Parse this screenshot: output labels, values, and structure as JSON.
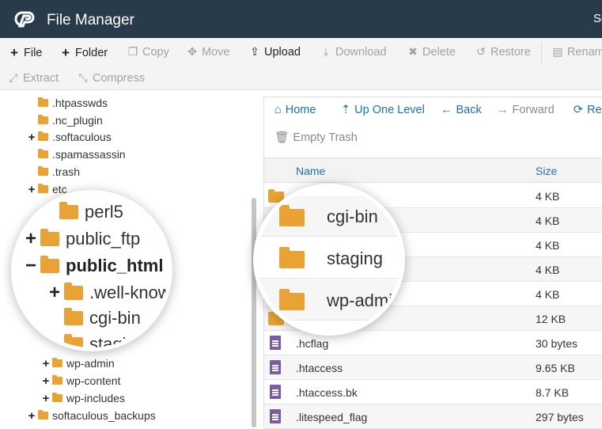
{
  "header": {
    "title": "File Manager",
    "user": "Se"
  },
  "toolbar": [
    {
      "label": "File",
      "icon": "+",
      "enabled": true
    },
    {
      "label": "Folder",
      "icon": "+",
      "enabled": true
    },
    {
      "label": "Copy",
      "icon": "copy-icon",
      "enabled": false
    },
    {
      "label": "Move",
      "icon": "move-icon",
      "enabled": false
    },
    {
      "label": "Upload",
      "icon": "upload-icon",
      "enabled": true
    },
    {
      "label": "Download",
      "icon": "download-icon",
      "enabled": false
    },
    {
      "label": "Delete",
      "icon": "x-icon",
      "enabled": false
    },
    {
      "label": "Restore",
      "icon": "undo-icon",
      "enabled": false
    },
    {
      "label": "Renam",
      "icon": "rename-icon",
      "enabled": false
    },
    {
      "label": "Extract",
      "icon": "expand-icon",
      "enabled": false
    },
    {
      "label": "Compress",
      "icon": "compress-icon",
      "enabled": false
    }
  ],
  "tree": [
    {
      "label": ".htpasswds",
      "expander": ""
    },
    {
      "label": ".nc_plugin",
      "expander": ""
    },
    {
      "label": ".softaculous",
      "expander": "+"
    },
    {
      "label": ".spamassassin",
      "expander": ""
    },
    {
      "label": ".trash",
      "expander": ""
    },
    {
      "label": "etc",
      "expander": "+"
    },
    {
      "label": "wp-admin",
      "expander": "+"
    },
    {
      "label": "wp-content",
      "expander": "+"
    },
    {
      "label": "wp-includes",
      "expander": "+"
    },
    {
      "label": "softaculous_backups",
      "expander": "+"
    }
  ],
  "nav": [
    {
      "label": "Home",
      "icon": "home-icon",
      "enabled": true
    },
    {
      "label": "Up One Level",
      "icon": "level-up-icon",
      "enabled": true
    },
    {
      "label": "Back",
      "icon": "arrow-left-icon",
      "enabled": true
    },
    {
      "label": "Forward",
      "icon": "arrow-right-icon",
      "enabled": false
    },
    {
      "label": "Re",
      "icon": "reload-icon",
      "enabled": true
    },
    {
      "label": "Empty Trash",
      "icon": "trash-icon",
      "enabled": false
    }
  ],
  "table": {
    "columns": [
      "Name",
      "Size"
    ],
    "rows": [
      {
        "name": "",
        "size": "4 KB",
        "type": "folder"
      },
      {
        "name": "",
        "size": "4 KB",
        "type": "folder"
      },
      {
        "name": "",
        "size": "4 KB",
        "type": "folder"
      },
      {
        "name": "",
        "size": "4 KB",
        "type": "folder"
      },
      {
        "name": "",
        "size": "4 KB",
        "type": "folder"
      },
      {
        "name": "",
        "size": "12 KB",
        "type": "folder"
      },
      {
        "name": ".hcflag",
        "size": "30 bytes",
        "type": "file"
      },
      {
        "name": ".htaccess",
        "size": "9.65 KB",
        "type": "file"
      },
      {
        "name": ".htaccess.bk",
        "size": "8.7 KB",
        "type": "file"
      },
      {
        "name": ".litespeed_flag",
        "size": "297 bytes",
        "type": "file"
      }
    ]
  },
  "zoom_left": [
    {
      "label": "perl5",
      "expander": "",
      "bold": false
    },
    {
      "label": "public_ftp",
      "expander": "+",
      "bold": false
    },
    {
      "label": "public_html",
      "expander": "−",
      "bold": true
    },
    {
      "label": ".well-know",
      "expander": "+",
      "bold": false
    },
    {
      "label": "cgi-bin",
      "expander": "",
      "bold": false
    },
    {
      "label": "stagin",
      "expander": "",
      "bold": false
    }
  ],
  "zoom_right": [
    {
      "label": "cgi-bin"
    },
    {
      "label": "staging"
    },
    {
      "label": "wp-admi"
    }
  ],
  "colors": {
    "header_bg": "#293a4a",
    "folder": "#e9a335",
    "link": "#1f6fb8",
    "file_icon": "#7c5aa6"
  }
}
